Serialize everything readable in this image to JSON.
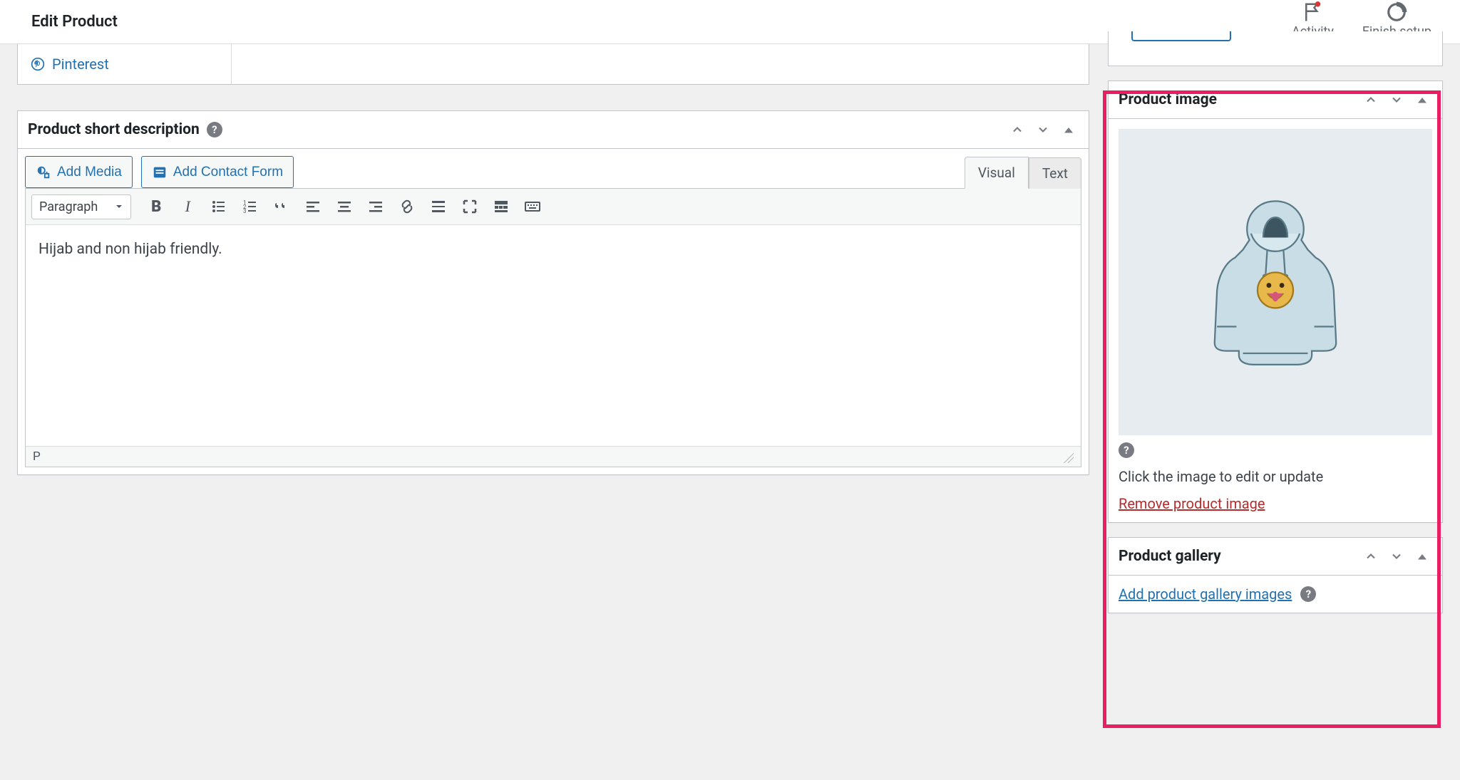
{
  "header": {
    "title": "Edit Product",
    "actions": {
      "activity": "Activity",
      "finish_setup": "Finish setup"
    }
  },
  "pinterest": {
    "label": "Pinterest"
  },
  "short_desc": {
    "title": "Product short description",
    "add_media": "Add Media",
    "add_contact_form": "Add Contact Form",
    "tab_visual": "Visual",
    "tab_text": "Text",
    "format_label": "Paragraph",
    "content": "Hijab and non hijab friendly.",
    "breadcrumb": "P"
  },
  "product_image": {
    "title": "Product image",
    "caption": "Click the image to edit or update",
    "remove": "Remove product image"
  },
  "product_gallery": {
    "title": "Product gallery",
    "add": "Add product gallery images"
  }
}
